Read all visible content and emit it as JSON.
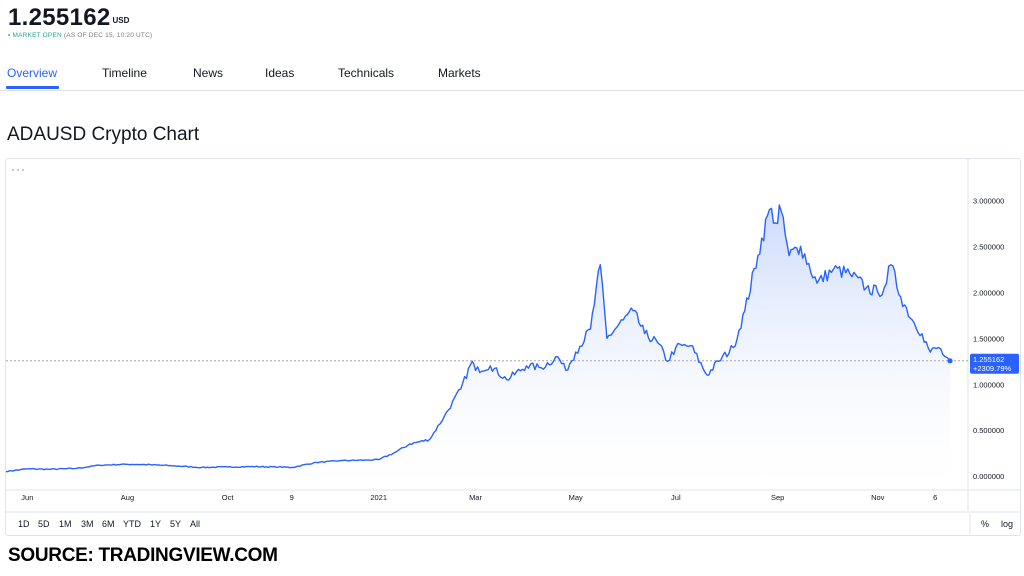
{
  "header": {
    "price": "1.255162",
    "currency": "USD",
    "status_dot": "•",
    "status": "MARKET OPEN",
    "as_of": "(AS OF DEC 15, 10:20 UTC)"
  },
  "tabs": [
    {
      "label": "Overview",
      "active": true
    },
    {
      "label": "Timeline"
    },
    {
      "label": "News"
    },
    {
      "label": "Ideas"
    },
    {
      "label": "Technicals"
    },
    {
      "label": "Markets"
    }
  ],
  "title": "ADAUSD Crypto Chart",
  "timeframes": [
    "1D",
    "5D",
    "1M",
    "3M",
    "6M",
    "YTD",
    "1Y",
    "5Y",
    "All"
  ],
  "scale_options": [
    "%",
    "log"
  ],
  "source": "SOURCE: TRADINGVIEW.COM",
  "colors": {
    "accent": "#2962ff",
    "line": "#2962ff",
    "area_top": "#cfdcfb",
    "status": "#26a69a"
  },
  "chart_data": {
    "type": "area",
    "ylim": [
      -0.15,
      3.45
    ],
    "y_ticks": [
      0.0,
      0.5,
      1.0,
      1.5,
      2.0,
      2.5,
      3.0
    ],
    "y_tick_labels": [
      "0.000000",
      "0.500000",
      "1.000000",
      "1.500000",
      "2.000000",
      "2.500000",
      "3.000000"
    ],
    "x_ticks": [
      {
        "label": "Jun",
        "date": "2020-06-01"
      },
      {
        "label": "Aug",
        "date": "2020-08-01"
      },
      {
        "label": "Oct",
        "date": "2020-10-01"
      },
      {
        "label": "9",
        "date": "2020-11-09"
      },
      {
        "label": "2021",
        "date": "2021-01-01"
      },
      {
        "label": "Mar",
        "date": "2021-03-01"
      },
      {
        "label": "May",
        "date": "2021-05-01"
      },
      {
        "label": "Jul",
        "date": "2021-07-01"
      },
      {
        "label": "Sep",
        "date": "2021-09-01"
      },
      {
        "label": "Nov",
        "date": "2021-11-01"
      },
      {
        "label": "6",
        "date": "2021-12-06"
      }
    ],
    "last_price_label": "1.255162",
    "change_label": "+2309.79%",
    "points": [
      [
        "2020-05-19",
        0.052
      ],
      [
        "2020-06-01",
        0.08
      ],
      [
        "2020-06-15",
        0.075
      ],
      [
        "2020-07-01",
        0.085
      ],
      [
        "2020-07-15",
        0.12
      ],
      [
        "2020-08-01",
        0.13
      ],
      [
        "2020-08-15",
        0.125
      ],
      [
        "2020-09-01",
        0.11
      ],
      [
        "2020-09-15",
        0.095
      ],
      [
        "2020-10-01",
        0.1
      ],
      [
        "2020-10-15",
        0.105
      ],
      [
        "2020-11-01",
        0.1
      ],
      [
        "2020-11-09",
        0.095
      ],
      [
        "2020-11-24",
        0.15
      ],
      [
        "2020-12-10",
        0.17
      ],
      [
        "2020-12-25",
        0.175
      ],
      [
        "2021-01-01",
        0.18
      ],
      [
        "2021-01-10",
        0.25
      ],
      [
        "2021-01-20",
        0.35
      ],
      [
        "2021-02-01",
        0.4
      ],
      [
        "2021-02-10",
        0.65
      ],
      [
        "2021-02-20",
        0.95
      ],
      [
        "2021-02-27",
        1.25
      ],
      [
        "2021-03-01",
        1.15
      ],
      [
        "2021-03-10",
        1.2
      ],
      [
        "2021-03-20",
        1.05
      ],
      [
        "2021-04-01",
        1.2
      ],
      [
        "2021-04-10",
        1.18
      ],
      [
        "2021-04-20",
        1.3
      ],
      [
        "2021-04-25",
        1.15
      ],
      [
        "2021-05-01",
        1.35
      ],
      [
        "2021-05-10",
        1.6
      ],
      [
        "2021-05-16",
        2.3
      ],
      [
        "2021-05-20",
        1.5
      ],
      [
        "2021-05-30",
        1.7
      ],
      [
        "2021-06-05",
        1.8
      ],
      [
        "2021-06-12",
        1.55
      ],
      [
        "2021-06-20",
        1.45
      ],
      [
        "2021-06-26",
        1.25
      ],
      [
        "2021-07-01",
        1.4
      ],
      [
        "2021-07-10",
        1.42
      ],
      [
        "2021-07-20",
        1.1
      ],
      [
        "2021-07-27",
        1.25
      ],
      [
        "2021-08-05",
        1.4
      ],
      [
        "2021-08-12",
        1.8
      ],
      [
        "2021-08-20",
        2.4
      ],
      [
        "2021-08-27",
        2.9
      ],
      [
        "2021-09-01",
        2.75
      ],
      [
        "2021-09-02",
        2.95
      ],
      [
        "2021-09-08",
        2.4
      ],
      [
        "2021-09-15",
        2.5
      ],
      [
        "2021-09-25",
        2.1
      ],
      [
        "2021-10-05",
        2.25
      ],
      [
        "2021-10-15",
        2.2
      ],
      [
        "2021-10-25",
        2.05
      ],
      [
        "2021-11-01",
        2.0
      ],
      [
        "2021-11-05",
        2.05
      ],
      [
        "2021-11-09",
        2.3
      ],
      [
        "2021-11-15",
        1.95
      ],
      [
        "2021-11-22",
        1.7
      ],
      [
        "2021-11-28",
        1.55
      ],
      [
        "2021-12-03",
        1.35
      ],
      [
        "2021-12-08",
        1.4
      ],
      [
        "2021-12-12",
        1.3
      ],
      [
        "2021-12-15",
        1.255162
      ]
    ]
  }
}
